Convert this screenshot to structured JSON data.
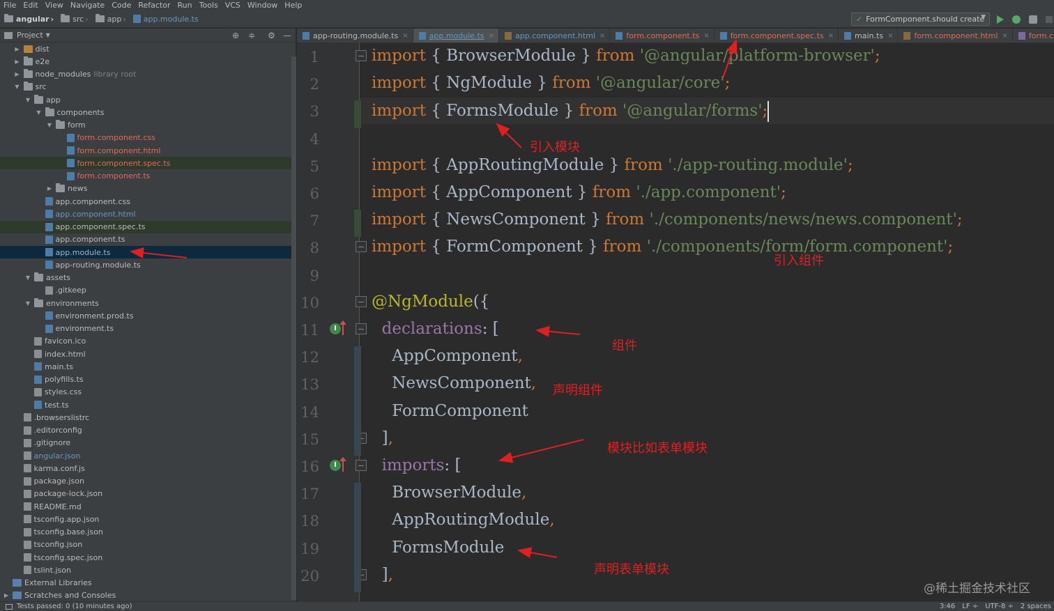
{
  "menu": [
    "File",
    "Edit",
    "View",
    "Navigate",
    "Code",
    "Refactor",
    "Run",
    "Tools",
    "VCS",
    "Window",
    "Help"
  ],
  "breadcrumb": [
    "angular",
    "src",
    "app",
    "app.module.ts"
  ],
  "run_config": "FormComponent.should create",
  "project": {
    "title": "Project",
    "tree": [
      {
        "label": "dist",
        "indent": 1,
        "arrow": "right",
        "icon": "folder-orange",
        "style": ""
      },
      {
        "label": "e2e",
        "indent": 1,
        "arrow": "right",
        "icon": "folder",
        "style": ""
      },
      {
        "label": "node_modules",
        "indent": 1,
        "arrow": "right",
        "icon": "folder",
        "style": "",
        "sub": "library root"
      },
      {
        "label": "src",
        "indent": 1,
        "arrow": "down",
        "icon": "folder",
        "style": ""
      },
      {
        "label": "app",
        "indent": 2,
        "arrow": "down",
        "icon": "folder",
        "style": ""
      },
      {
        "label": "components",
        "indent": 3,
        "arrow": "down",
        "icon": "folder",
        "style": ""
      },
      {
        "label": "form",
        "indent": 4,
        "arrow": "down",
        "icon": "folder",
        "style": ""
      },
      {
        "label": "form.component.css",
        "indent": 5,
        "arrow": "",
        "icon": "file-ts",
        "style": "red"
      },
      {
        "label": "form.component.html",
        "indent": 5,
        "arrow": "",
        "icon": "file-ts",
        "style": "red"
      },
      {
        "label": "form.component.spec.ts",
        "indent": 5,
        "arrow": "",
        "icon": "file-ts",
        "style": "red",
        "row": "hl"
      },
      {
        "label": "form.component.ts",
        "indent": 5,
        "arrow": "",
        "icon": "file-ts",
        "style": "red"
      },
      {
        "label": "news",
        "indent": 4,
        "arrow": "right",
        "icon": "folder",
        "style": ""
      },
      {
        "label": "app.component.css",
        "indent": 3,
        "arrow": "",
        "icon": "file-ts",
        "style": ""
      },
      {
        "label": "app.component.html",
        "indent": 3,
        "arrow": "",
        "icon": "file-ts",
        "style": "blue"
      },
      {
        "label": "app.component.spec.ts",
        "indent": 3,
        "arrow": "",
        "icon": "file-ts",
        "style": "",
        "row": "hl"
      },
      {
        "label": "app.component.ts",
        "indent": 3,
        "arrow": "",
        "icon": "file-ts",
        "style": ""
      },
      {
        "label": "app.module.ts",
        "indent": 3,
        "arrow": "",
        "icon": "file-ts",
        "style": "hi",
        "row": "sel"
      },
      {
        "label": "app-routing.module.ts",
        "indent": 3,
        "arrow": "",
        "icon": "file-ts",
        "style": ""
      },
      {
        "label": "assets",
        "indent": 2,
        "arrow": "down",
        "icon": "folder",
        "style": ""
      },
      {
        "label": ".gitkeep",
        "indent": 3,
        "arrow": "",
        "icon": "file-gen",
        "style": ""
      },
      {
        "label": "environments",
        "indent": 2,
        "arrow": "down",
        "icon": "folder",
        "style": ""
      },
      {
        "label": "environment.prod.ts",
        "indent": 3,
        "arrow": "",
        "icon": "file-ts",
        "style": ""
      },
      {
        "label": "environment.ts",
        "indent": 3,
        "arrow": "",
        "icon": "file-ts",
        "style": ""
      },
      {
        "label": "favicon.ico",
        "indent": 2,
        "arrow": "",
        "icon": "file-gen",
        "style": ""
      },
      {
        "label": "index.html",
        "indent": 2,
        "arrow": "",
        "icon": "file-gen",
        "style": ""
      },
      {
        "label": "main.ts",
        "indent": 2,
        "arrow": "",
        "icon": "file-ts",
        "style": ""
      },
      {
        "label": "polyfills.ts",
        "indent": 2,
        "arrow": "",
        "icon": "file-ts",
        "style": ""
      },
      {
        "label": "styles.css",
        "indent": 2,
        "arrow": "",
        "icon": "file-gen",
        "style": ""
      },
      {
        "label": "test.ts",
        "indent": 2,
        "arrow": "",
        "icon": "file-ts",
        "style": ""
      },
      {
        "label": ".browserslistrc",
        "indent": 1,
        "arrow": "",
        "icon": "file-gen",
        "style": ""
      },
      {
        "label": ".editorconfig",
        "indent": 1,
        "arrow": "",
        "icon": "file-gen",
        "style": ""
      },
      {
        "label": ".gitignore",
        "indent": 1,
        "arrow": "",
        "icon": "file-gen",
        "style": ""
      },
      {
        "label": "angular.json",
        "indent": 1,
        "arrow": "",
        "icon": "file-gen",
        "style": "blue"
      },
      {
        "label": "karma.conf.js",
        "indent": 1,
        "arrow": "",
        "icon": "file-gen",
        "style": ""
      },
      {
        "label": "package.json",
        "indent": 1,
        "arrow": "",
        "icon": "file-gen",
        "style": ""
      },
      {
        "label": "package-lock.json",
        "indent": 1,
        "arrow": "",
        "icon": "file-gen",
        "style": ""
      },
      {
        "label": "README.md",
        "indent": 1,
        "arrow": "",
        "icon": "file-gen",
        "style": ""
      },
      {
        "label": "tsconfig.app.json",
        "indent": 1,
        "arrow": "",
        "icon": "file-gen",
        "style": ""
      },
      {
        "label": "tsconfig.base.json",
        "indent": 1,
        "arrow": "",
        "icon": "file-gen",
        "style": ""
      },
      {
        "label": "tsconfig.json",
        "indent": 1,
        "arrow": "",
        "icon": "file-gen",
        "style": ""
      },
      {
        "label": "tsconfig.spec.json",
        "indent": 1,
        "arrow": "",
        "icon": "file-gen",
        "style": ""
      },
      {
        "label": "tslint.json",
        "indent": 1,
        "arrow": "",
        "icon": "file-gen",
        "style": ""
      },
      {
        "label": "External Libraries",
        "indent": 0,
        "arrow": "",
        "icon": "folder-blue",
        "style": ""
      },
      {
        "label": "Scratches and Consoles",
        "indent": 0,
        "arrow": "right",
        "icon": "folder-blue",
        "style": ""
      }
    ]
  },
  "tabs": [
    {
      "label": "app-routing.module.ts",
      "type": "ts",
      "style": ""
    },
    {
      "label": "app.module.ts",
      "type": "ts",
      "style": "active"
    },
    {
      "label": "app.component.html",
      "type": "html",
      "style": "blue"
    },
    {
      "label": "form.component.ts",
      "type": "ts",
      "style": "red"
    },
    {
      "label": "form.component.spec.ts",
      "type": "ts",
      "style": "red"
    },
    {
      "label": "main.ts",
      "type": "ts",
      "style": ""
    },
    {
      "label": "form.component.html",
      "type": "html",
      "style": "red"
    },
    {
      "label": "form.component.css",
      "type": "css",
      "style": "red"
    }
  ],
  "code_lines": [
    [
      [
        "kw",
        "import"
      ],
      [
        "t",
        " { BrowserModule } "
      ],
      [
        "kw",
        "from"
      ],
      [
        "t",
        " "
      ],
      [
        "str",
        "'@angular/platform-browser'"
      ],
      [
        "kw",
        ";"
      ]
    ],
    [
      [
        "kw",
        "import"
      ],
      [
        "t",
        " { NgModule } "
      ],
      [
        "kw",
        "from"
      ],
      [
        "t",
        " "
      ],
      [
        "str",
        "'@angular/core'"
      ],
      [
        "kw",
        ";"
      ]
    ],
    [
      [
        "kw",
        "import"
      ],
      [
        "t",
        " { FormsModule } "
      ],
      [
        "kw",
        "from"
      ],
      [
        "t",
        " "
      ],
      [
        "str",
        "'@angular/forms'"
      ],
      [
        "kw",
        ";"
      ]
    ],
    [],
    [
      [
        "kw",
        "import"
      ],
      [
        "t",
        " { AppRoutingModule } "
      ],
      [
        "kw",
        "from"
      ],
      [
        "t",
        " "
      ],
      [
        "str",
        "'./app-routing.module'"
      ],
      [
        "kw",
        ";"
      ]
    ],
    [
      [
        "kw",
        "import"
      ],
      [
        "t",
        " { AppComponent } "
      ],
      [
        "kw",
        "from"
      ],
      [
        "t",
        " "
      ],
      [
        "str",
        "'./app.component'"
      ],
      [
        "kw",
        ";"
      ]
    ],
    [
      [
        "kw",
        "import"
      ],
      [
        "t",
        " { NewsComponent } "
      ],
      [
        "kw",
        "from"
      ],
      [
        "t",
        " "
      ],
      [
        "str",
        "'./components/news/news.component'"
      ],
      [
        "kw",
        ";"
      ]
    ],
    [
      [
        "kw",
        "import"
      ],
      [
        "t",
        " { FormComponent } "
      ],
      [
        "kw",
        "from"
      ],
      [
        "t",
        " "
      ],
      [
        "str",
        "'./components/form/form.component'"
      ],
      [
        "kw",
        ";"
      ]
    ],
    [],
    [
      [
        "dec",
        "@NgModule"
      ],
      [
        "t",
        "({"
      ]
    ],
    [
      [
        "t",
        "  "
      ],
      [
        "prop",
        "declarations"
      ],
      [
        "t",
        ": ["
      ]
    ],
    [
      [
        "t",
        "    AppComponent"
      ],
      [
        "kw",
        ","
      ]
    ],
    [
      [
        "t",
        "    NewsComponent"
      ],
      [
        "kw",
        ","
      ]
    ],
    [
      [
        "t",
        "    FormComponent"
      ]
    ],
    [
      [
        "t",
        "  ]"
      ],
      [
        "kw",
        ","
      ]
    ],
    [
      [
        "t",
        "  "
      ],
      [
        "prop",
        "imports"
      ],
      [
        "t",
        ": ["
      ]
    ],
    [
      [
        "t",
        "    BrowserModule"
      ],
      [
        "kw",
        ","
      ]
    ],
    [
      [
        "t",
        "    AppRoutingModule"
      ],
      [
        "kw",
        ","
      ]
    ],
    [
      [
        "t",
        "    FormsModule"
      ]
    ],
    [
      [
        "t",
        "  ]"
      ],
      [
        "kw",
        ","
      ]
    ]
  ],
  "annotations": {
    "import_module": "引入模块",
    "import_component": "引入组件",
    "component": "组件",
    "declare_component": "声明组件",
    "module_example": "模块比如表单模块",
    "declare_forms_module": "声明表单模块"
  },
  "watermark": "@稀土掘金技术社区",
  "status": {
    "left": "Tests passed: 0 (10 minutes ago)",
    "position": "3:46",
    "line_sep": "LF ÷",
    "encoding": "UTF-8 ÷",
    "indent": "2 spaces"
  }
}
